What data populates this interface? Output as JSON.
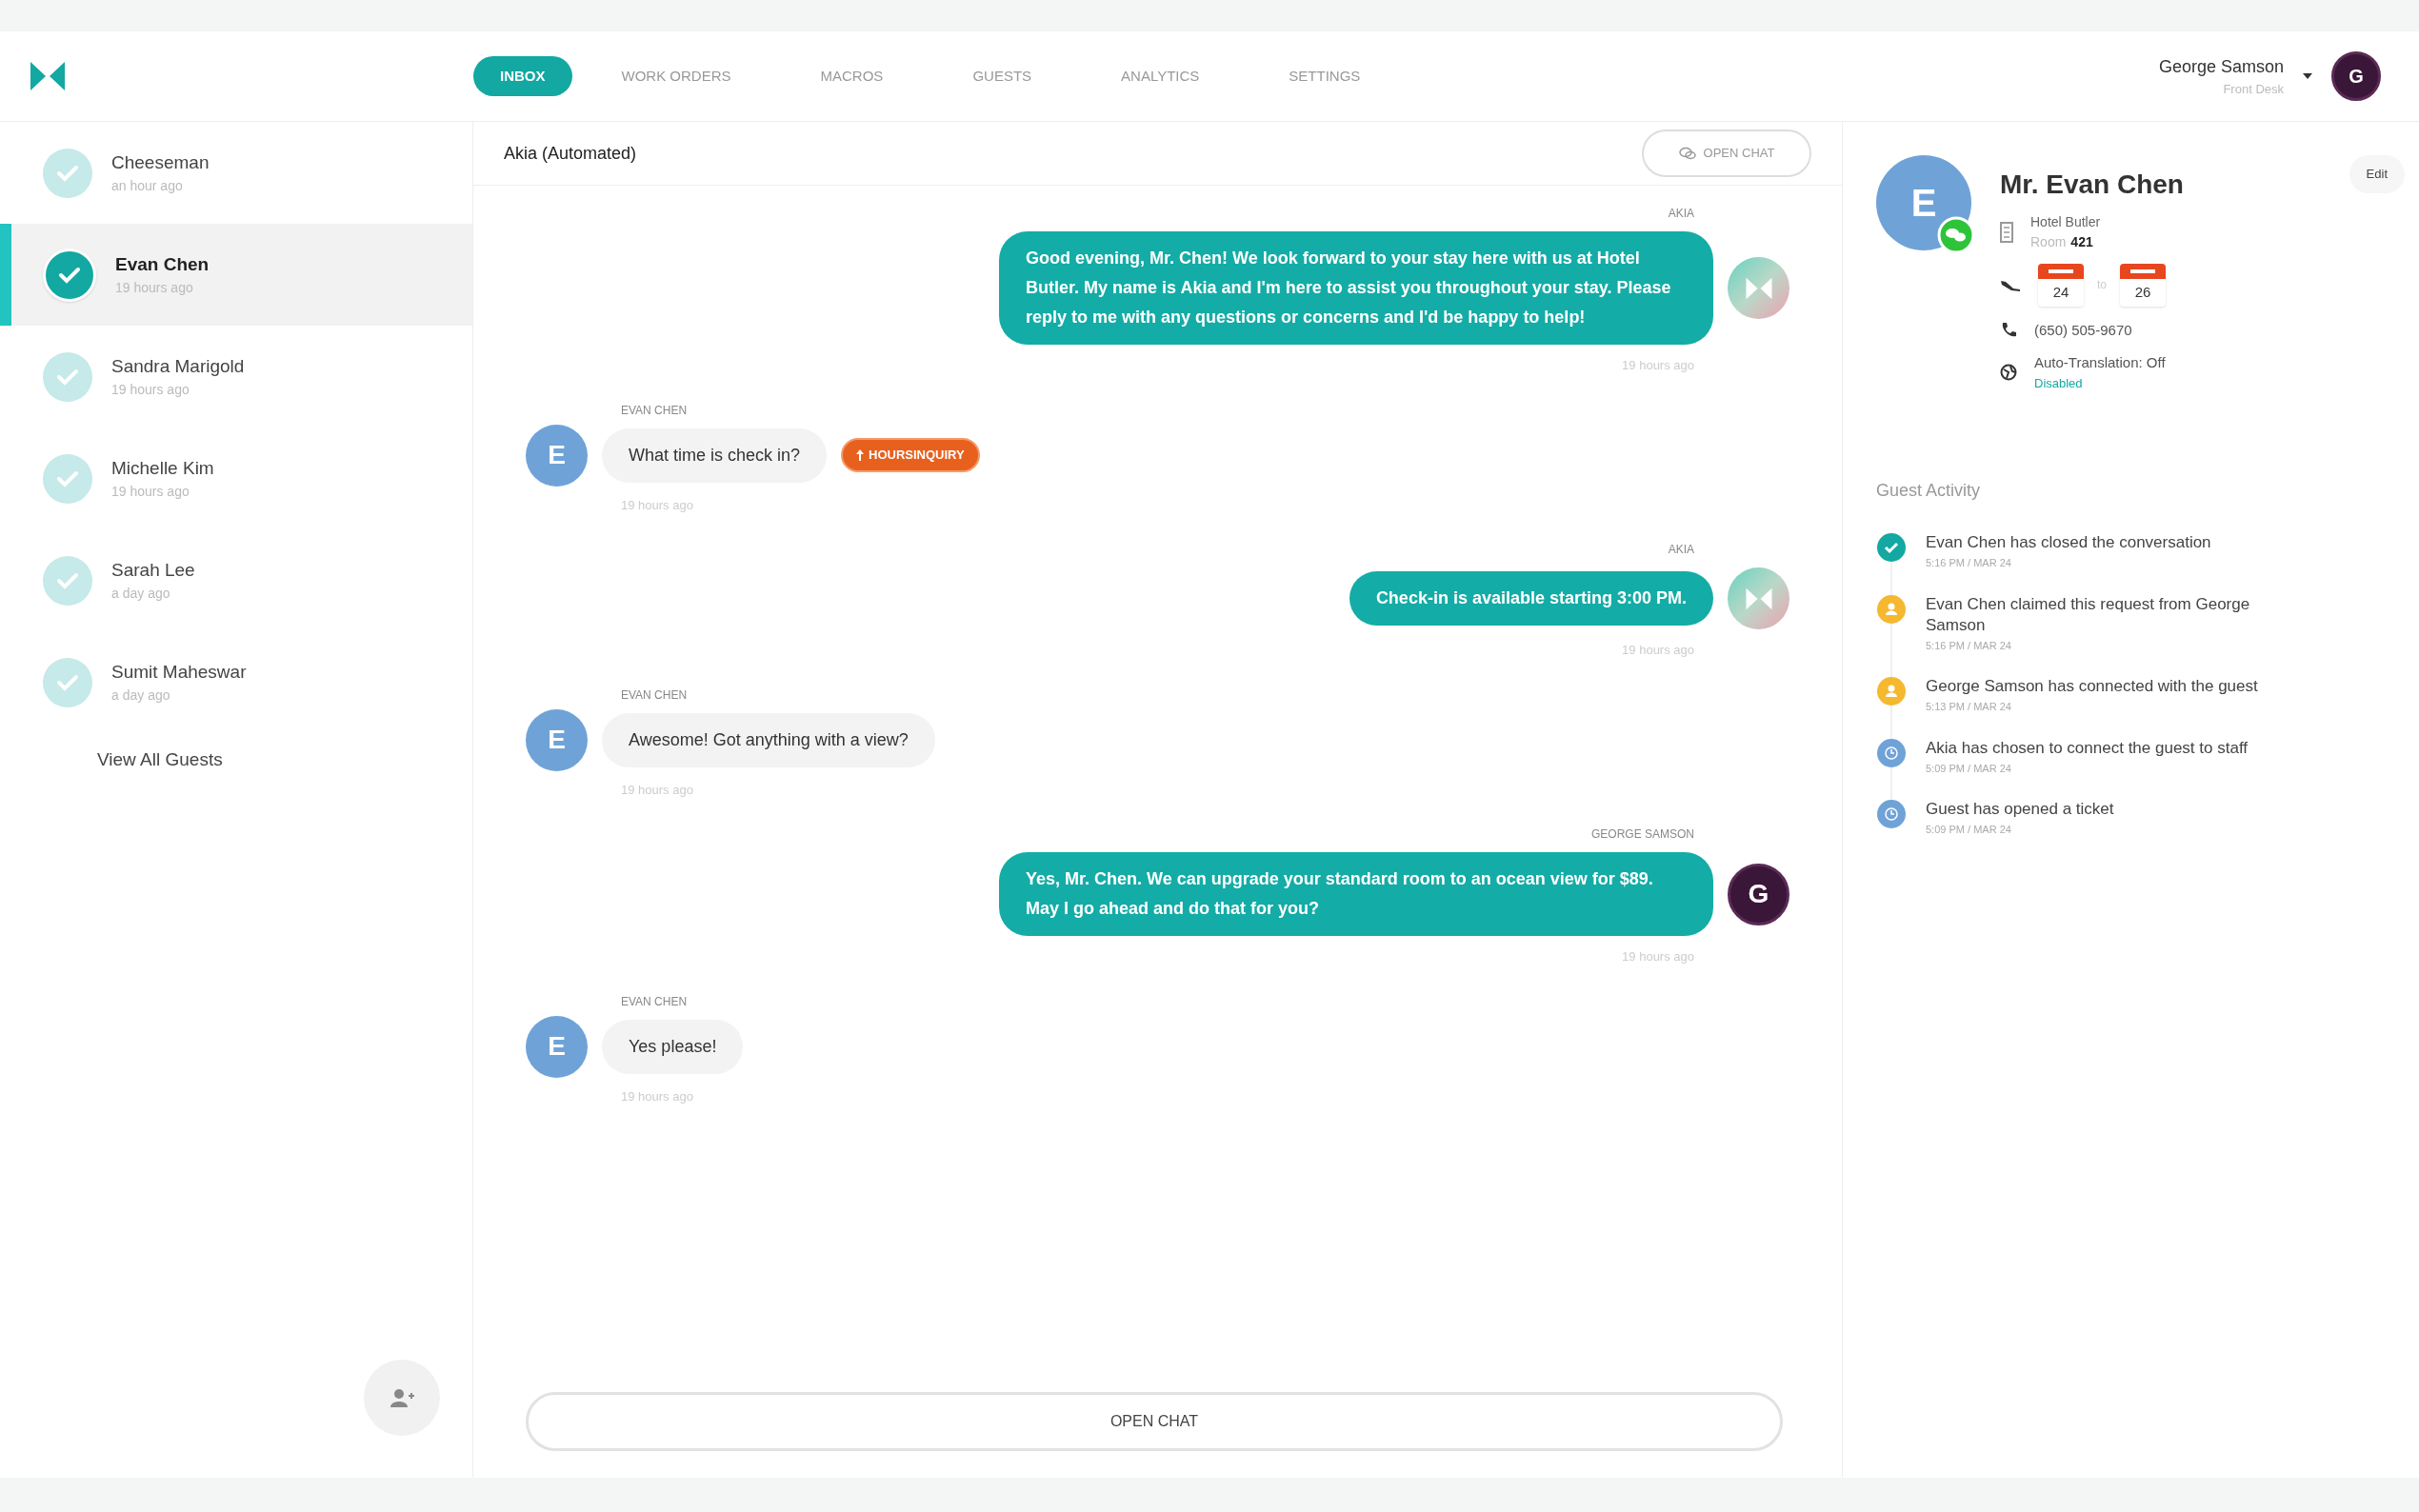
{
  "nav": [
    {
      "label": "INBOX",
      "selected": true
    },
    {
      "label": "WORK ORDERS",
      "selected": false
    },
    {
      "label": "MACROS",
      "selected": false
    },
    {
      "label": "GUESTS",
      "selected": false
    },
    {
      "label": "ANALYTICS",
      "selected": false
    },
    {
      "label": "SETTINGS",
      "selected": false
    }
  ],
  "user": {
    "name": "George Samson",
    "role": "Front Desk",
    "avatar": "G"
  },
  "guests": [
    {
      "name": "Cheeseman",
      "time": "an hour ago",
      "selected": false
    },
    {
      "name": "Evan Chen",
      "time": "19 hours ago",
      "selected": true
    },
    {
      "name": "Sandra Marigold",
      "time": "19 hours ago",
      "selected": false
    },
    {
      "name": "Michelle Kim",
      "time": "19 hours ago",
      "selected": false
    },
    {
      "name": "Sarah Lee",
      "time": "a day ago",
      "selected": false
    },
    {
      "name": "Sumit Maheswar",
      "time": "a day ago",
      "selected": false
    }
  ],
  "view_all": "View All Guests",
  "chat": {
    "title": "Akia (Automated)",
    "open_chat_top": "OPEN CHAT",
    "open_chat_bottom": "OPEN CHAT",
    "messages": [
      {
        "kind": "outgoing",
        "sender": "AKIA",
        "text": "Good evening, Mr. Chen! We look forward to your stay here with us at Hotel Butler. My name is Akia and I'm here to assist you throughout your stay. Please reply to me with any questions or concerns and I'd be happy to help!",
        "time": "19 hours ago",
        "avatar": {
          "kind": "logo"
        }
      },
      {
        "kind": "incoming",
        "sender": "EVAN CHEN",
        "text": "What time is check in?",
        "time": "19 hours ago",
        "avatar": {
          "kind": "letter",
          "letter": "E"
        },
        "tag": "HOURSINQUIRY"
      },
      {
        "kind": "outgoing",
        "sender": "AKIA",
        "text": "Check-in is available starting 3:00 PM.",
        "time": "19 hours ago",
        "avatar": {
          "kind": "logo"
        }
      },
      {
        "kind": "incoming",
        "sender": "EVAN CHEN",
        "text": "Awesome! Got anything with a view?",
        "time": "19 hours ago",
        "avatar": {
          "kind": "letter",
          "letter": "E"
        }
      },
      {
        "kind": "outgoing",
        "sender": "GEORGE SAMSON",
        "text": "Yes, Mr. Chen. We can upgrade your standard room to an ocean view for $89. May I go ahead and do that for you?",
        "time": "19 hours ago",
        "avatar": {
          "kind": "letter",
          "letter": "G"
        }
      },
      {
        "kind": "incoming",
        "sender": "EVAN CHEN",
        "text": "Yes please!",
        "time": "19 hours ago",
        "avatar": {
          "kind": "letter",
          "letter": "E"
        }
      }
    ]
  },
  "profile": {
    "avatar": "E",
    "name": "Mr. Evan Chen",
    "edit": "Edit",
    "hotel": "Hotel Butler",
    "room_label": "Room",
    "room": "421",
    "check_in_day": "24",
    "to": "to",
    "check_out_day": "26",
    "phone": "(650) 505-9670",
    "translation": "Auto-Translation: Off",
    "translation_status": "Disabled"
  },
  "activity_title": "Guest Activity",
  "activity": [
    {
      "kind": "check",
      "color": "#13a8a2",
      "text": "Evan Chen has closed the conversation",
      "time": "5:16 PM / MAR 24"
    },
    {
      "kind": "person",
      "color": "#f5b82e",
      "text": "Evan Chen claimed this request from George Samson",
      "time": "5:16 PM / MAR 24"
    },
    {
      "kind": "person",
      "color": "#f5b82e",
      "text": "George Samson has connected with the guest",
      "time": "5:13 PM / MAR 24"
    },
    {
      "kind": "clock",
      "color": "#6fa3d8",
      "text": "Akia has chosen to connect the guest to staff",
      "time": "5:09 PM / MAR 24"
    },
    {
      "kind": "clock",
      "color": "#6fa3d8",
      "text": "Guest has opened a ticket",
      "time": "5:09 PM / MAR 24"
    }
  ]
}
